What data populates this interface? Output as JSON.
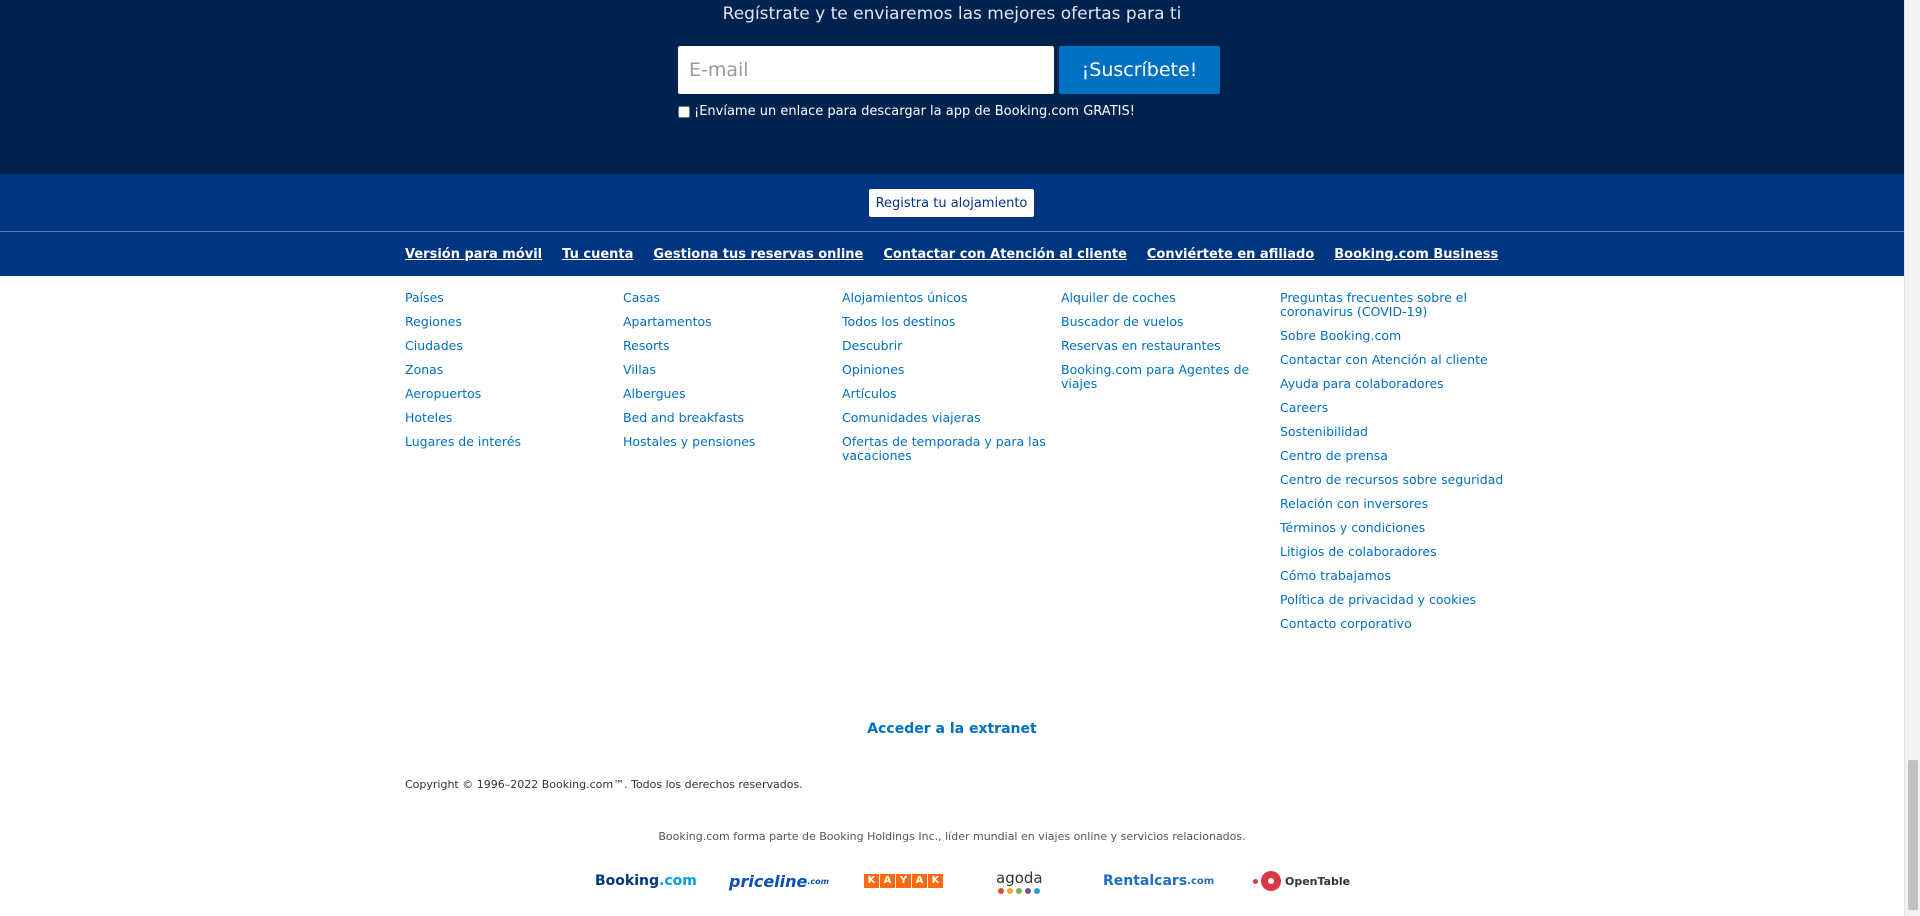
{
  "newsletter": {
    "subtitle": "Regístrate y te enviaremos las mejores ofertas para ti",
    "email_placeholder": "E-mail",
    "subscribe_label": "¡Suscríbete!",
    "app_link_label": "¡Envíame un enlace para descargar la app de Booking.com GRATIS!"
  },
  "register": {
    "label": "Registra tu alojamiento"
  },
  "top_links": [
    "Versión para móvil",
    "Tu cuenta",
    "Gestiona tus reservas online",
    "Contactar con Atención al cliente",
    "Conviértete en afiliado",
    "Booking.com Business"
  ],
  "columns": [
    [
      "Países",
      "Regiones",
      "Ciudades",
      "Zonas",
      "Aeropuertos",
      "Hoteles",
      "Lugares de interés"
    ],
    [
      "Casas",
      "Apartamentos",
      "Resorts",
      "Villas",
      "Albergues",
      "Bed and breakfasts",
      "Hostales y pensiones"
    ],
    [
      "Alojamientos únicos",
      "Todos los destinos",
      "Descubrir",
      "Opiniones",
      "Artículos",
      "Comunidades viajeras",
      "Ofertas de temporada y para las vacaciones"
    ],
    [
      "Alquiler de coches",
      "Buscador de vuelos",
      "Reservas en restaurantes",
      "Booking.com para Agentes de viajes"
    ],
    [
      "Preguntas frecuentes sobre el coronavirus (COVID-19)",
      "Sobre Booking.com",
      "Contactar con Atención al cliente",
      "Ayuda para colaboradores",
      "Careers",
      "Sostenibilidad",
      "Centro de prensa",
      "Centro de recursos sobre seguridad",
      "Relación con inversores",
      "Términos y condiciones",
      "Litigios de colaboradores",
      "Cómo trabajamos",
      "Política de privacidad y cookies",
      "Contacto corporativo"
    ]
  ],
  "extranet": {
    "label": "Acceder a la extranet"
  },
  "copyright": "Copyright © 1996–2022 Booking.com™. Todos los derechos reservados.",
  "holdings": "Booking.com forma parte de Booking Holdings Inc., líder mundial en viajes online y servicios relacionados.",
  "brands": {
    "booking_main": "Booking",
    "booking_tld": ".com",
    "priceline_main": "priceline",
    "priceline_tld": ".com",
    "kayak_letters": [
      "K",
      "A",
      "Y",
      "A",
      "K"
    ],
    "agoda": "agoda",
    "agoda_dot_colors": [
      "#e4463f",
      "#f5a623",
      "#7cb342",
      "#7b4ea3",
      "#2b9bd3"
    ],
    "rentalcars_main": "Rentalcars",
    "rentalcars_tld": ".com",
    "opentable": "OpenTable"
  },
  "colors": {
    "newsletter_bg": "#00224f",
    "brand_blue": "#003580",
    "link_blue": "#0071c2"
  }
}
